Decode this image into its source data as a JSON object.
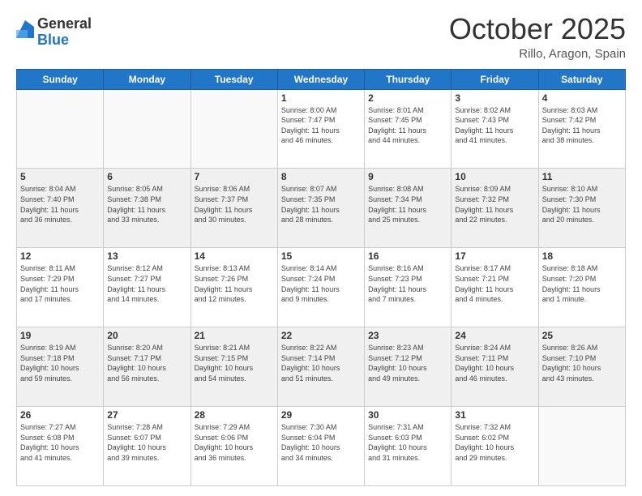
{
  "header": {
    "logo_general": "General",
    "logo_blue": "Blue",
    "title": "October 2025",
    "location": "Rillo, Aragon, Spain"
  },
  "weekdays": [
    "Sunday",
    "Monday",
    "Tuesday",
    "Wednesday",
    "Thursday",
    "Friday",
    "Saturday"
  ],
  "weeks": [
    [
      {
        "day": "",
        "info": ""
      },
      {
        "day": "",
        "info": ""
      },
      {
        "day": "",
        "info": ""
      },
      {
        "day": "1",
        "info": "Sunrise: 8:00 AM\nSunset: 7:47 PM\nDaylight: 11 hours\nand 46 minutes."
      },
      {
        "day": "2",
        "info": "Sunrise: 8:01 AM\nSunset: 7:45 PM\nDaylight: 11 hours\nand 44 minutes."
      },
      {
        "day": "3",
        "info": "Sunrise: 8:02 AM\nSunset: 7:43 PM\nDaylight: 11 hours\nand 41 minutes."
      },
      {
        "day": "4",
        "info": "Sunrise: 8:03 AM\nSunset: 7:42 PM\nDaylight: 11 hours\nand 38 minutes."
      }
    ],
    [
      {
        "day": "5",
        "info": "Sunrise: 8:04 AM\nSunset: 7:40 PM\nDaylight: 11 hours\nand 36 minutes."
      },
      {
        "day": "6",
        "info": "Sunrise: 8:05 AM\nSunset: 7:38 PM\nDaylight: 11 hours\nand 33 minutes."
      },
      {
        "day": "7",
        "info": "Sunrise: 8:06 AM\nSunset: 7:37 PM\nDaylight: 11 hours\nand 30 minutes."
      },
      {
        "day": "8",
        "info": "Sunrise: 8:07 AM\nSunset: 7:35 PM\nDaylight: 11 hours\nand 28 minutes."
      },
      {
        "day": "9",
        "info": "Sunrise: 8:08 AM\nSunset: 7:34 PM\nDaylight: 11 hours\nand 25 minutes."
      },
      {
        "day": "10",
        "info": "Sunrise: 8:09 AM\nSunset: 7:32 PM\nDaylight: 11 hours\nand 22 minutes."
      },
      {
        "day": "11",
        "info": "Sunrise: 8:10 AM\nSunset: 7:30 PM\nDaylight: 11 hours\nand 20 minutes."
      }
    ],
    [
      {
        "day": "12",
        "info": "Sunrise: 8:11 AM\nSunset: 7:29 PM\nDaylight: 11 hours\nand 17 minutes."
      },
      {
        "day": "13",
        "info": "Sunrise: 8:12 AM\nSunset: 7:27 PM\nDaylight: 11 hours\nand 14 minutes."
      },
      {
        "day": "14",
        "info": "Sunrise: 8:13 AM\nSunset: 7:26 PM\nDaylight: 11 hours\nand 12 minutes."
      },
      {
        "day": "15",
        "info": "Sunrise: 8:14 AM\nSunset: 7:24 PM\nDaylight: 11 hours\nand 9 minutes."
      },
      {
        "day": "16",
        "info": "Sunrise: 8:16 AM\nSunset: 7:23 PM\nDaylight: 11 hours\nand 7 minutes."
      },
      {
        "day": "17",
        "info": "Sunrise: 8:17 AM\nSunset: 7:21 PM\nDaylight: 11 hours\nand 4 minutes."
      },
      {
        "day": "18",
        "info": "Sunrise: 8:18 AM\nSunset: 7:20 PM\nDaylight: 11 hours\nand 1 minute."
      }
    ],
    [
      {
        "day": "19",
        "info": "Sunrise: 8:19 AM\nSunset: 7:18 PM\nDaylight: 10 hours\nand 59 minutes."
      },
      {
        "day": "20",
        "info": "Sunrise: 8:20 AM\nSunset: 7:17 PM\nDaylight: 10 hours\nand 56 minutes."
      },
      {
        "day": "21",
        "info": "Sunrise: 8:21 AM\nSunset: 7:15 PM\nDaylight: 10 hours\nand 54 minutes."
      },
      {
        "day": "22",
        "info": "Sunrise: 8:22 AM\nSunset: 7:14 PM\nDaylight: 10 hours\nand 51 minutes."
      },
      {
        "day": "23",
        "info": "Sunrise: 8:23 AM\nSunset: 7:12 PM\nDaylight: 10 hours\nand 49 minutes."
      },
      {
        "day": "24",
        "info": "Sunrise: 8:24 AM\nSunset: 7:11 PM\nDaylight: 10 hours\nand 46 minutes."
      },
      {
        "day": "25",
        "info": "Sunrise: 8:26 AM\nSunset: 7:10 PM\nDaylight: 10 hours\nand 43 minutes."
      }
    ],
    [
      {
        "day": "26",
        "info": "Sunrise: 7:27 AM\nSunset: 6:08 PM\nDaylight: 10 hours\nand 41 minutes."
      },
      {
        "day": "27",
        "info": "Sunrise: 7:28 AM\nSunset: 6:07 PM\nDaylight: 10 hours\nand 39 minutes."
      },
      {
        "day": "28",
        "info": "Sunrise: 7:29 AM\nSunset: 6:06 PM\nDaylight: 10 hours\nand 36 minutes."
      },
      {
        "day": "29",
        "info": "Sunrise: 7:30 AM\nSunset: 6:04 PM\nDaylight: 10 hours\nand 34 minutes."
      },
      {
        "day": "30",
        "info": "Sunrise: 7:31 AM\nSunset: 6:03 PM\nDaylight: 10 hours\nand 31 minutes."
      },
      {
        "day": "31",
        "info": "Sunrise: 7:32 AM\nSunset: 6:02 PM\nDaylight: 10 hours\nand 29 minutes."
      },
      {
        "day": "",
        "info": ""
      }
    ]
  ]
}
